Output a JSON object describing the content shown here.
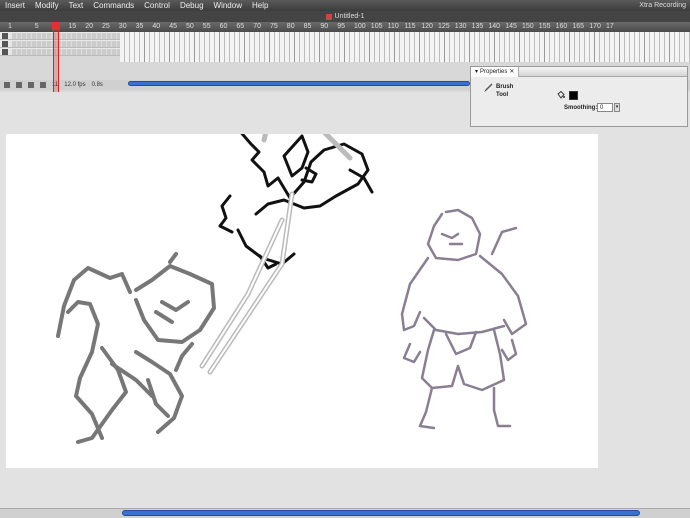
{
  "menu": {
    "items": [
      "Insert",
      "Modify",
      "Text",
      "Commands",
      "Control",
      "Debug",
      "Window",
      "Help"
    ],
    "right_text": "Xtra Recording"
  },
  "document": {
    "title": "Untitled-1"
  },
  "timeline": {
    "ruler": [
      "1",
      "5",
      "10",
      "15",
      "20",
      "25",
      "30",
      "35",
      "40",
      "45",
      "50",
      "55",
      "60",
      "65",
      "70",
      "75",
      "80",
      "85",
      "90",
      "95",
      "100",
      "105",
      "110",
      "115",
      "120",
      "125",
      "130",
      "135",
      "140",
      "145",
      "150",
      "155",
      "160",
      "165",
      "170",
      "17"
    ],
    "status": {
      "frame": "11",
      "fps": "12.0 fps",
      "time": "0.8s"
    }
  },
  "properties": {
    "tab_label": "Properties",
    "tool_name_line1": "Brush",
    "tool_name_line2": "Tool",
    "smoothing_label": "Smoothing:",
    "smoothing_value": "0",
    "fill_color": "#000000"
  },
  "colors": {
    "scrollbar": "#3c6fd1",
    "playhead": "#dd2222"
  }
}
